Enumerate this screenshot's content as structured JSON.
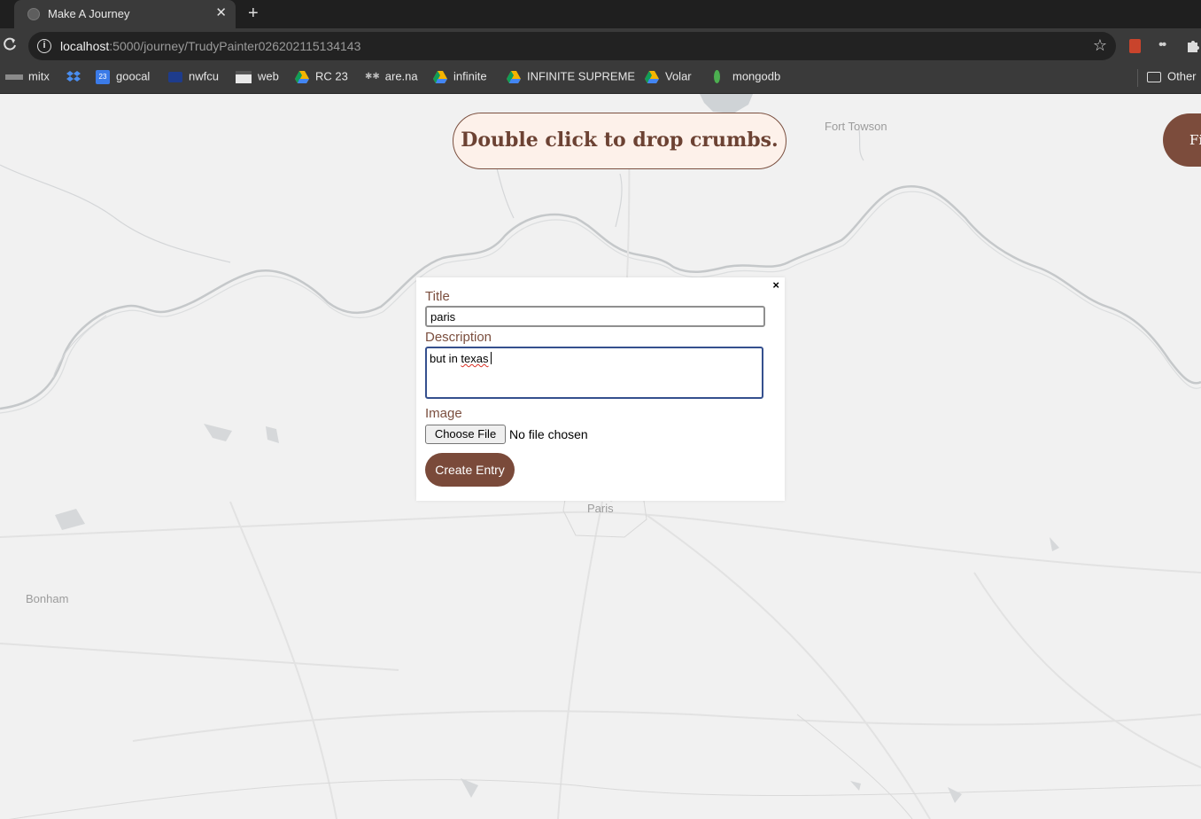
{
  "browser": {
    "tab_title": "Make A Journey",
    "url_host": "localhost",
    "url_path": ":5000/journey/TrudyPainter026202115134143",
    "bookmarks": [
      {
        "label": "mitx",
        "icon": "mitx-icon"
      },
      {
        "label": "",
        "icon": "dropbox-icon"
      },
      {
        "label": "goocal",
        "icon": "calendar-icon"
      },
      {
        "label": "nwfcu",
        "icon": "nwfcu-icon"
      },
      {
        "label": "web",
        "icon": "page-icon"
      },
      {
        "label": "RC 23",
        "icon": "drive-icon"
      },
      {
        "label": "are.na",
        "icon": "arena-icon"
      },
      {
        "label": "infinite",
        "icon": "drive-icon"
      },
      {
        "label": "INFINITE SUPREME",
        "icon": "drive-icon"
      },
      {
        "label": "Volar",
        "icon": "drive-icon"
      },
      {
        "label": "mongodb",
        "icon": "mongodb-leaf-icon"
      }
    ],
    "other_bookmarks": "Other"
  },
  "map": {
    "labels": {
      "fort_towson": "Fort Towson",
      "paris": "Paris",
      "bonham": "Bonham"
    }
  },
  "hint": "Double click to drop crumbs.",
  "side_button": "Fi",
  "modal": {
    "close": "×",
    "title_label": "Title",
    "title_value": "paris",
    "description_label": "Description",
    "description_value_plain": "but in ",
    "description_value_typo": "texas",
    "image_label": "Image",
    "choose_file": "Choose File",
    "file_status": "No file chosen",
    "submit": "Create Entry"
  },
  "colors": {
    "accent_brown": "#7a4a3a",
    "hint_background": "#fdf1ea",
    "map_background": "#f1f1f1"
  }
}
